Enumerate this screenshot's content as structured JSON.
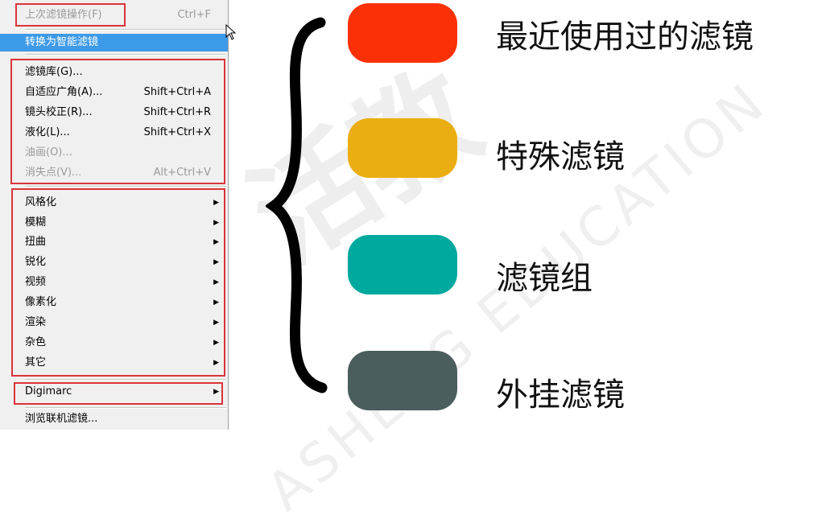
{
  "menu": {
    "last_filter": {
      "label": "上次滤镜操作(F)",
      "shortcut": "Ctrl+F"
    },
    "convert_smart": {
      "label": "转换为智能滤镜"
    },
    "special": [
      {
        "label": "滤镜库(G)...",
        "shortcut": ""
      },
      {
        "label": "自适应广角(A)...",
        "shortcut": "Shift+Ctrl+A"
      },
      {
        "label": "镜头校正(R)...",
        "shortcut": "Shift+Ctrl+R"
      },
      {
        "label": "液化(L)...",
        "shortcut": "Shift+Ctrl+X"
      },
      {
        "label": "油画(O)...",
        "shortcut": ""
      },
      {
        "label": "消失点(V)...",
        "shortcut": "Alt+Ctrl+V"
      }
    ],
    "groups": [
      "风格化",
      "模糊",
      "扭曲",
      "锐化",
      "视频",
      "像素化",
      "渲染",
      "杂色",
      "其它"
    ],
    "plugin": {
      "label": "Digimarc"
    },
    "browse": {
      "label": "浏览联机滤镜..."
    }
  },
  "legend": [
    {
      "label": "最近使用过的滤镜",
      "color": "#fa3107"
    },
    {
      "label": "特殊滤镜",
      "color": "#ebae12"
    },
    {
      "label": "滤镜组",
      "color": "#00a99e"
    },
    {
      "label": "外挂滤镜",
      "color": "#4b5d5d"
    }
  ],
  "watermark": {
    "main": "活教",
    "sub": "ASHENG EDUCATION"
  },
  "colors": {
    "highlight": "#3d9ae8",
    "box": "#d9343a",
    "disabled": "#9a9a9a"
  }
}
